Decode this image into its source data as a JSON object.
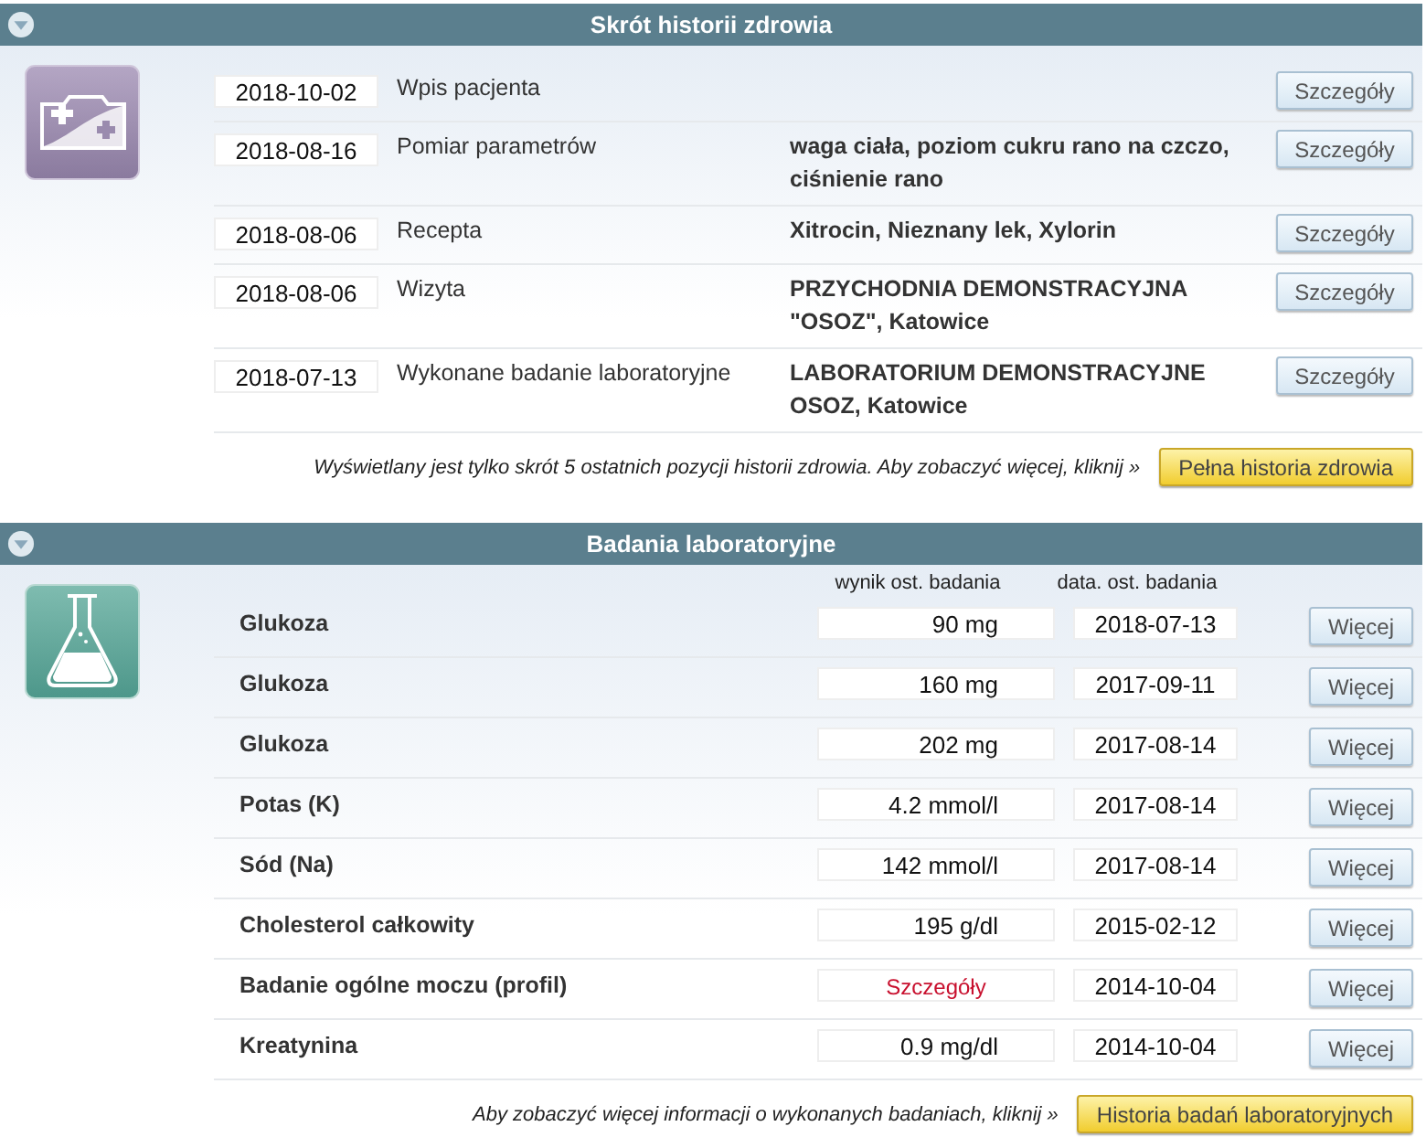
{
  "history": {
    "title": "Skrót historii zdrowia",
    "entries": [
      {
        "date": "2018-10-02",
        "type": "Wpis pacjenta",
        "button": "Szczegóły"
      },
      {
        "date": "2018-08-16",
        "type": "Pomiar parametrów",
        "detail": "waga ciała, poziom cukru rano na czczo, ciśnienie rano",
        "button": "Szczegóły"
      },
      {
        "date": "2018-08-06",
        "type": "Recepta",
        "detail": "Xitrocin, Nieznany lek, Xylorin",
        "button": "Szczegóły"
      },
      {
        "date": "2018-08-06",
        "type": "Wizyta",
        "detail": "PRZYCHODNIA DEMONSTRACYJNA \"OSOZ\", Katowice",
        "button": "Szczegóły"
      },
      {
        "date": "2018-07-13",
        "type": "Wykonane badanie laboratoryjne",
        "detail": "LABORATORIUM DEMONSTRACYJNE OSOZ, Katowice",
        "button": "Szczegóły"
      }
    ],
    "footer_note": "Wyświetlany jest tylko skrót 5 ostatnich pozycji historii zdrowia. Aby zobaczyć więcej, kliknij »",
    "footer_button": "Pełna historia zdrowia"
  },
  "labs": {
    "title": "Badania laboratoryjne",
    "columns": [
      "wynik ost. badania",
      "data. ost. badania"
    ],
    "rows": [
      {
        "name": "Glukoza",
        "result": "90 mg",
        "kind": "value",
        "date": "2018-07-13",
        "button": "Więcej"
      },
      {
        "name": "Glukoza",
        "result": "160 mg",
        "kind": "value",
        "date": "2017-09-11",
        "button": "Więcej"
      },
      {
        "name": "Glukoza",
        "result": "202 mg",
        "kind": "value",
        "date": "2017-08-14",
        "button": "Więcej"
      },
      {
        "name": "Potas (K)",
        "result": "4.2 mmol/l",
        "kind": "value",
        "date": "2017-08-14",
        "button": "Więcej"
      },
      {
        "name": "Sód (Na)",
        "result": "142 mmol/l",
        "kind": "value",
        "date": "2017-08-14",
        "button": "Więcej"
      },
      {
        "name": "Cholesterol całkowity",
        "result": "195 g/dl",
        "kind": "value",
        "date": "2015-02-12",
        "button": "Więcej"
      },
      {
        "name": "Badanie ogólne moczu (profil)",
        "result": "Szczegóły",
        "kind": "link",
        "date": "2014-10-04",
        "button": "Więcej"
      },
      {
        "name": "Kreatynina",
        "result": "0.9 mg/dl",
        "kind": "value",
        "date": "2014-10-04",
        "button": "Więcej"
      }
    ],
    "footer_note": "Aby zobaczyć więcej informacji o wykonanych badaniach, kliknij »",
    "footer_button": "Historia badań laboratoryjnych"
  }
}
